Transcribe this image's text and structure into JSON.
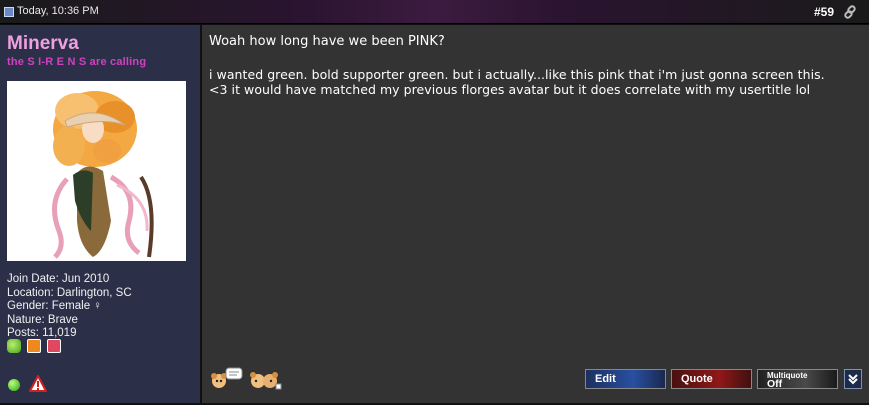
{
  "header": {
    "date": "Today, 10:36 PM",
    "post_number": "#59"
  },
  "author": {
    "username": "Minerva",
    "usertitle": "the S I-R E N S are calling",
    "info": [
      "Join Date: Jun 2010",
      "Location: Darlington, SC",
      "Gender: Female ♀",
      "Nature: Brave",
      "Posts: 11,019"
    ]
  },
  "message": {
    "title": "Woah how long have we been PINK?",
    "lines": [
      "i wanted green. bold supporter green. but i actually...like this pink that i'm just gonna screen this.",
      "<3 it would have matched my previous florges avatar but it does correlate with my usertitle lol"
    ]
  },
  "buttons": {
    "edit": "Edit",
    "quote": "Quote",
    "multiquote_label": "Multiquote",
    "multiquote_state": "Off"
  },
  "colors": {
    "username": "#f0a0e0",
    "usertitle": "#d040c0",
    "sidebar_bg": "#2b3048",
    "content_bg": "#333333"
  }
}
